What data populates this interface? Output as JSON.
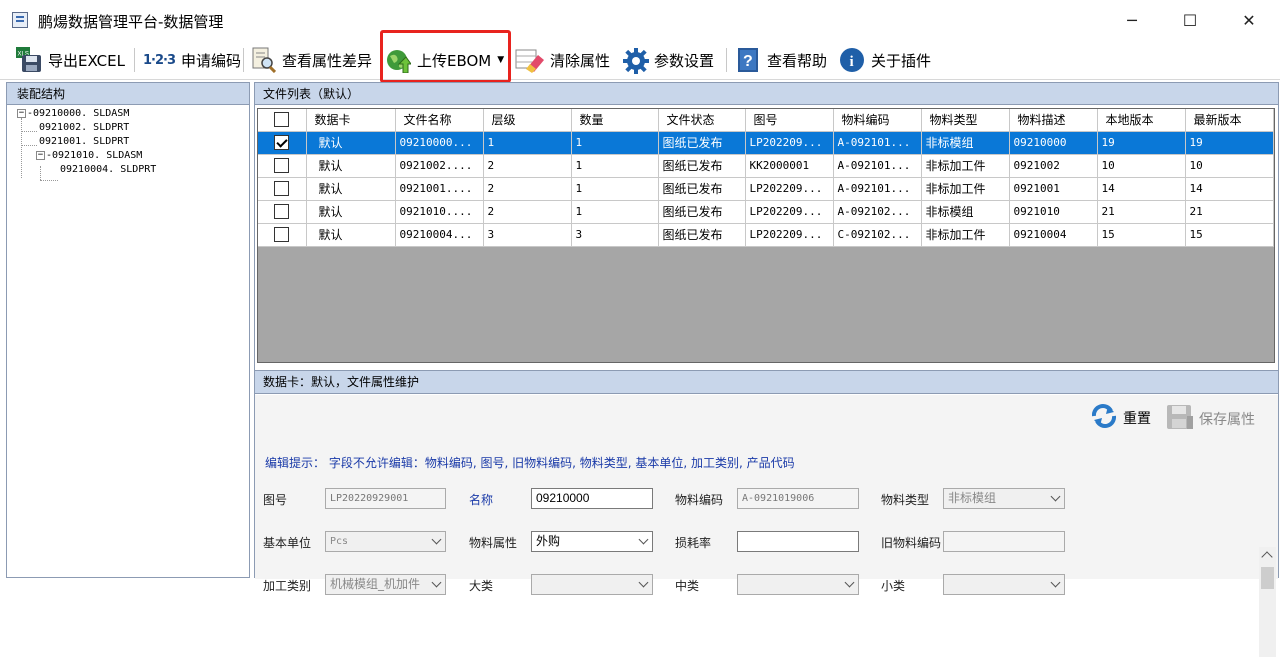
{
  "window": {
    "title": "鹏煬数据管理平台-数据管理",
    "minimize": "─",
    "maximize": "☐",
    "close": "✕"
  },
  "toolbar": {
    "export_excel": "导出EXCEL",
    "apply_code_prefix": "1·2·3",
    "apply_code": "申请编码",
    "view_diff": "查看属性差异",
    "upload_ebom": "上传EBOM",
    "clear_attrs": "清除属性",
    "param_settings": "参数设置",
    "view_help": "查看帮助",
    "about_plugin": "关于插件",
    "help_icon_text": "?",
    "info_icon_text": "i",
    "xls_text": "XLS"
  },
  "left_panel": {
    "title": "装配结构",
    "tree": [
      "-09210000. SLDASM",
      "0921002. SLDPRT",
      "0921001. SLDPRT",
      "-0921010. SLDASM",
      "09210004. SLDPRT"
    ],
    "expand_sign": "−"
  },
  "file_list": {
    "title": "文件列表（默认）",
    "columns": [
      "数据卡",
      "文件名称",
      "层级",
      "数量",
      "文件状态",
      "图号",
      "物料编码",
      "物料类型",
      "物料描述",
      "本地版本",
      "最新版本"
    ],
    "rows": [
      {
        "checked": true,
        "cells": [
          "默认",
          "09210000...",
          "1",
          "1",
          "图纸已发布",
          "LP202209...",
          "A-092101...",
          "非标模组",
          "09210000",
          "19",
          "19"
        ]
      },
      {
        "checked": false,
        "cells": [
          "默认",
          "0921002....",
          "2",
          "1",
          "图纸已发布",
          "KK2000001",
          "A-092101...",
          "非标加工件",
          "0921002",
          "10",
          "10"
        ]
      },
      {
        "checked": false,
        "cells": [
          "默认",
          "0921001....",
          "2",
          "1",
          "图纸已发布",
          "LP202209...",
          "A-092101...",
          "非标加工件",
          "0921001",
          "14",
          "14"
        ]
      },
      {
        "checked": false,
        "cells": [
          "默认",
          "0921010....",
          "2",
          "1",
          "图纸已发布",
          "LP202209...",
          "A-092102...",
          "非标模组",
          "0921010",
          "21",
          "21"
        ]
      },
      {
        "checked": false,
        "cells": [
          "默认",
          "09210004...",
          "3",
          "3",
          "图纸已发布",
          "LP202209...",
          "C-092102...",
          "非标加工件",
          "09210004",
          "15",
          "15"
        ]
      }
    ]
  },
  "detail": {
    "title": "数据卡：默认，文件属性维护",
    "reset": "重置",
    "save": "保存属性",
    "edit_hint": "编辑提示： 字段不允许编辑：物料编码, 图号, 旧物料编码, 物料类型, 基本单位, 加工类别, 产品代码",
    "fields": {
      "drawing_no_label": "图号",
      "drawing_no": "LP20220929001",
      "name_label": "名称",
      "name": "09210000",
      "material_code_label": "物料编码",
      "material_code": "A-0921019006",
      "material_type_label": "物料类型",
      "material_type": "非标模组",
      "base_unit_label": "基本单位",
      "base_unit": "Pcs",
      "material_attr_label": "物料属性",
      "material_attr": "外购",
      "loss_rate_label": "损耗率",
      "loss_rate": "",
      "old_code_label": "旧物料编码",
      "old_code": "",
      "process_type_label": "加工类别",
      "process_type": "机械模组_机加件",
      "major_label": "大类",
      "major": "",
      "middle_label": "中类",
      "middle": "",
      "minor_label": "小类",
      "minor": ""
    }
  },
  "colors": {
    "highlight": "#e8231e",
    "selected_row": "#0a78d7",
    "panel_header": "#c8d6ea",
    "hint_text": "#1a3aa8"
  }
}
